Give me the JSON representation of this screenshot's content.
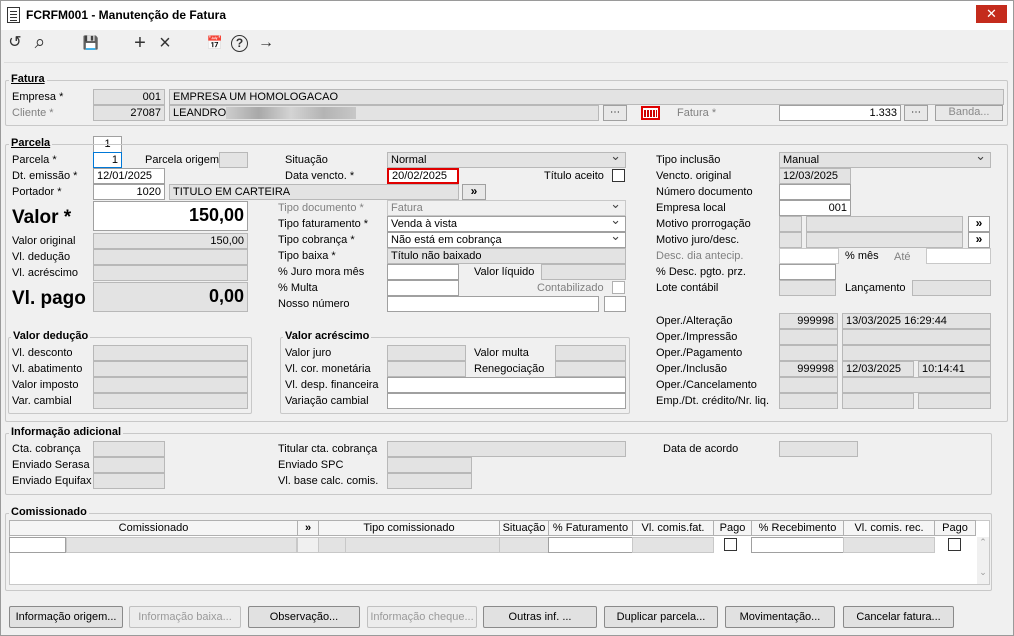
{
  "window": {
    "title": "FCRFM001 - Manutenção de Fatura",
    "close": "✕"
  },
  "toolbar": {
    "undo": "↺",
    "search": "⌕",
    "save": "💾",
    "add": "+",
    "remove": "×",
    "calendar": "📅",
    "help": "?",
    "exit": "→"
  },
  "fatura": {
    "group": "Fatura",
    "empresa_label": "Empresa *",
    "empresa_code": "001",
    "empresa_name": "EMPRESA UM HOMOLOGACAO",
    "cliente_label": "Cliente *",
    "cliente_code": "27087",
    "cliente_name": "LEANDRO",
    "fatura_label": "Fatura *",
    "fatura_value": "1.333",
    "banda_label": "Banda..."
  },
  "parcela_tab": "1",
  "parcela": {
    "group": "Parcela",
    "parcela_label": "Parcela *",
    "parcela_value": "1",
    "parcela_origem_label": "Parcela origem",
    "dt_emissao_label": "Dt. emissão *",
    "dt_emissao": "12/01/2025",
    "portador_label": "Portador *",
    "portador_code": "1020",
    "portador_name": "TITULO EM CARTEIRA",
    "valor_label": "Valor *",
    "valor": "150,00",
    "valor_original_label": "Valor original",
    "valor_original": "150,00",
    "vl_deducao_label": "Vl. dedução",
    "vl_acrescimo_label": "Vl. acréscimo",
    "vl_pago_label": "Vl. pago",
    "vl_pago": "0,00",
    "situacao_label": "Situação",
    "situacao": "Normal",
    "data_vencto_label": "Data vencto. *",
    "data_vencto": "20/02/2025",
    "titulo_aceito_label": "Título aceito",
    "tipo_documento_label": "Tipo documento *",
    "tipo_documento": "Fatura",
    "tipo_faturamento_label": "Tipo faturamento *",
    "tipo_faturamento": "Venda à vista",
    "tipo_cobranca_label": "Tipo cobrança *",
    "tipo_cobranca": "Não está em cobrança",
    "tipo_baixa_label": "Tipo baixa *",
    "tipo_baixa": "Título não baixado",
    "juro_mora_label": "% Juro mora mês",
    "valor_liquido_label": "Valor líquido",
    "multa_label": "% Multa",
    "contabilizado_label": "Contabilizado",
    "nosso_numero_label": "Nosso número",
    "tipo_inclusao_label": "Tipo inclusão",
    "tipo_inclusao": "Manual",
    "vencto_original_label": "Vencto. original",
    "vencto_original": "12/03/2025",
    "numero_documento_label": "Número documento",
    "empresa_local_label": "Empresa local",
    "empresa_local": "001",
    "motivo_prorrogacao_label": "Motivo prorrogação",
    "motivo_juro_label": "Motivo juro/desc.",
    "desc_dia_label": "Desc. dia antecip.",
    "pct_mes_label": "% mês",
    "ate_label": "Até",
    "desc_pgto_label": "% Desc. pgto. prz.",
    "lote_contabil_label": "Lote contábil",
    "lancamento_label": "Lançamento",
    "oper_alteracao_label": "Oper./Alteração",
    "oper_alteracao_user": "999998",
    "oper_alteracao_dt": "13/03/2025 16:29:44",
    "oper_impressao_label": "Oper./Impressão",
    "oper_pagamento_label": "Oper./Pagamento",
    "oper_inclusao_label": "Oper./Inclusão",
    "oper_inclusao_user": "999998",
    "oper_inclusao_date": "12/03/2025",
    "oper_inclusao_time": "10:14:41",
    "oper_cancelamento_label": "Oper./Cancelamento",
    "emp_dt_credito_label": "Emp./Dt. crédito/Nr. liq."
  },
  "valor_deducao": {
    "group": "Valor dedução",
    "desconto": "Vl. desconto",
    "abatimento": "Vl. abatimento",
    "imposto": "Valor imposto",
    "cambial": "Var. cambial"
  },
  "valor_acrescimo": {
    "group": "Valor acréscimo",
    "juro": "Valor juro",
    "cor_monetaria": "Vl. cor. monetária",
    "desp_financeira": "Vl. desp. financeira",
    "variacao_cambial": "Variação cambial",
    "multa": "Valor multa",
    "renegociacao": "Renegociação"
  },
  "info_adicional": {
    "group": "Informação adicional",
    "cta_cobranca": "Cta. cobrança",
    "enviado_serasa": "Enviado Serasa",
    "enviado_equifax": "Enviado Equifax",
    "titular_cta": "Titular cta. cobrança",
    "enviado_spc": "Enviado SPC",
    "vl_base_calc": "Vl. base calc. comis.",
    "data_acordo": "Data de acordo"
  },
  "comissionado": {
    "group": "Comissionado",
    "columns": [
      "Comissionado",
      "»",
      "Tipo comissionado",
      "Situação",
      "% Faturamento",
      "Vl. comis.fat.",
      "Pago",
      "% Recebimento",
      "Vl. comis. rec.",
      "Pago"
    ]
  },
  "buttons": {
    "info_origem": "Informação origem...",
    "info_baixa": "Informação baixa...",
    "observacao": "Observação...",
    "info_cheque": "Informação cheque...",
    "outras_inf": "Outras inf. ...",
    "duplicar": "Duplicar parcela...",
    "movimentacao": "Movimentação...",
    "cancelar": "Cancelar fatura..."
  }
}
